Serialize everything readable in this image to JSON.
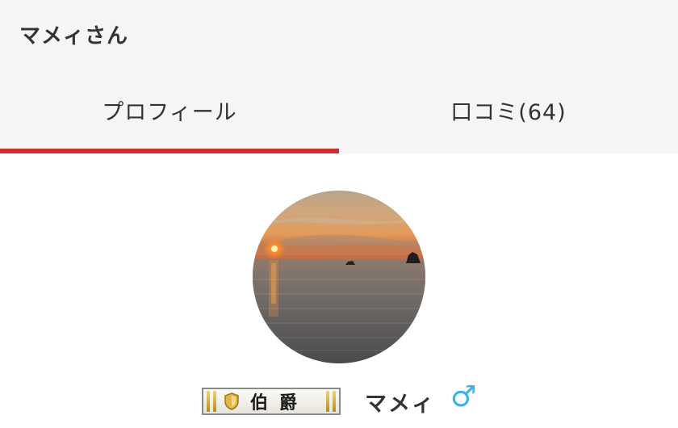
{
  "header": {
    "title": "マメィさん"
  },
  "tabs": [
    {
      "label": "プロフィール",
      "active": true
    },
    {
      "label": "口コミ(64)",
      "active": false
    }
  ],
  "profile": {
    "avatar_icon": "sunset-sea-photo",
    "rank": "伯爵",
    "rank_icon": "shield-icon",
    "name": "マメィ",
    "gender_symbol": "♂",
    "gender_icon": "male-icon"
  },
  "colors": {
    "tab_indicator": "#d12d2d",
    "header_bg": "#f5f5f5",
    "gender_icon": "#3bb3e6",
    "rank_gold": "#c99a2e"
  }
}
